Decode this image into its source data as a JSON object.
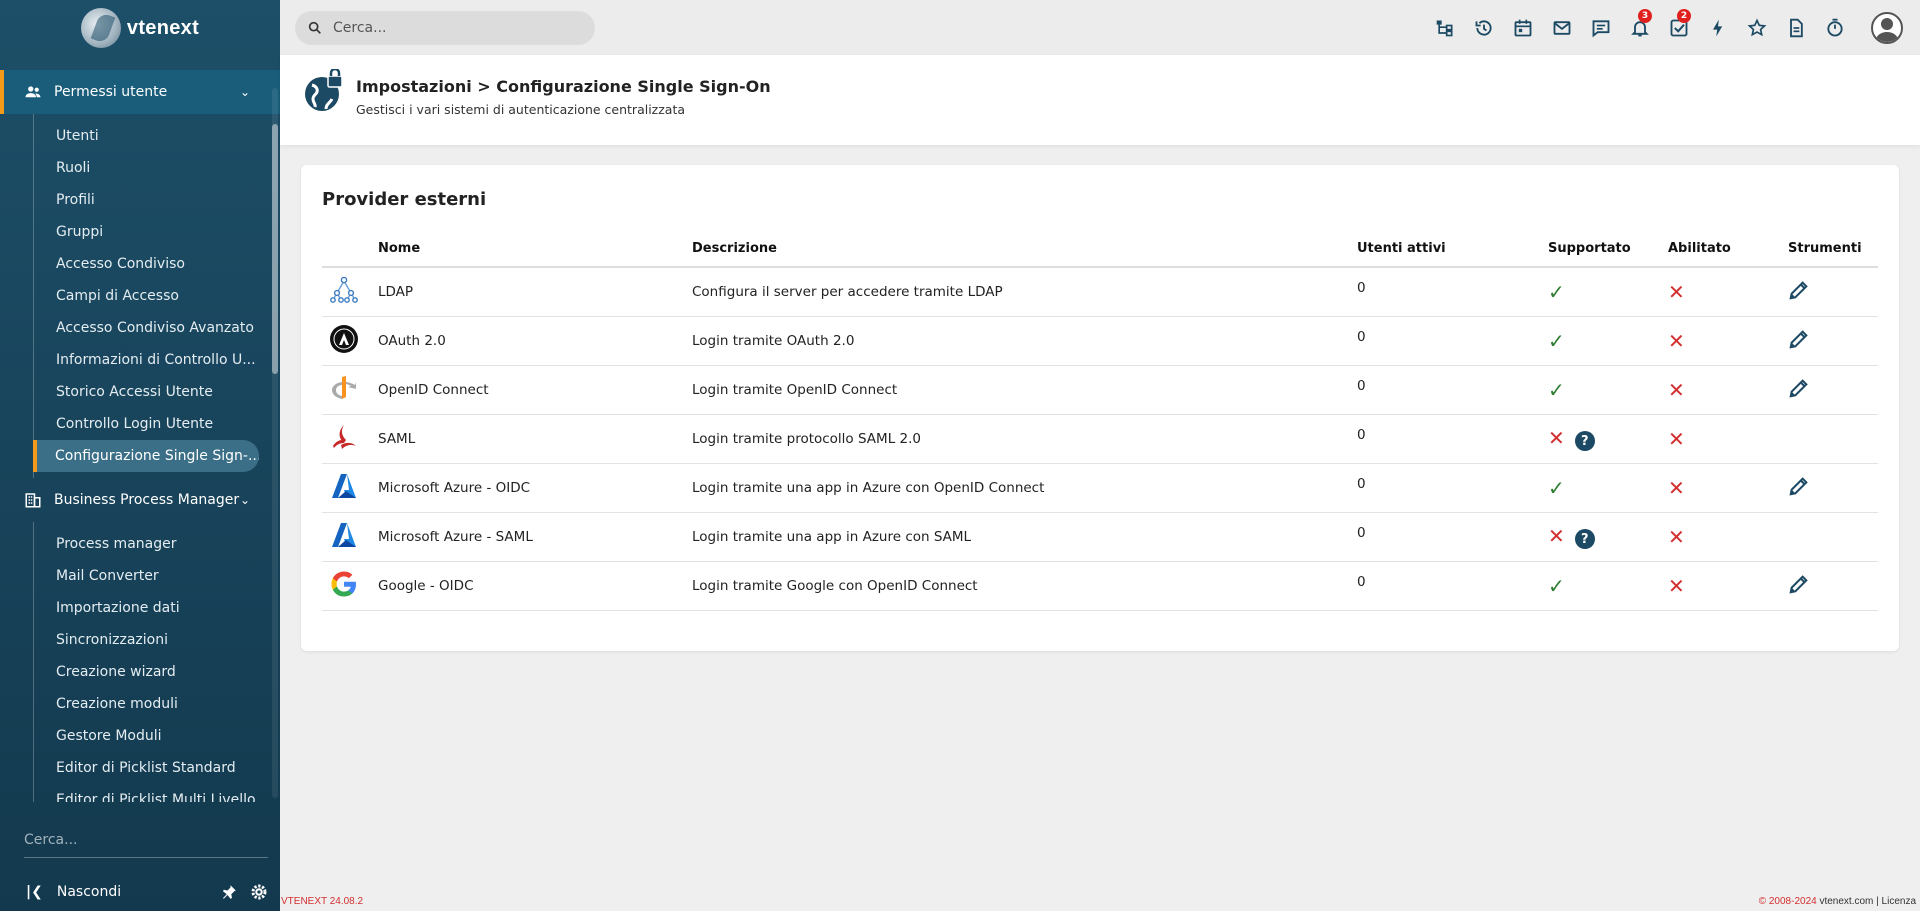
{
  "app": {
    "logo_text": "vtenext",
    "version": "VTENEXT 24.08.2"
  },
  "topbar": {
    "search_placeholder": "Cerca...",
    "icons": [
      {
        "name": "org-chart-icon",
        "badge": null
      },
      {
        "name": "history-icon",
        "badge": null
      },
      {
        "name": "calendar-icon",
        "badge": null
      },
      {
        "name": "mail-icon",
        "badge": null
      },
      {
        "name": "chat-icon",
        "badge": null
      },
      {
        "name": "bell-icon",
        "badge": "3"
      },
      {
        "name": "task-check-icon",
        "badge": "2"
      },
      {
        "name": "bolt-icon",
        "badge": null
      },
      {
        "name": "star-icon",
        "badge": null
      },
      {
        "name": "document-icon",
        "badge": null
      },
      {
        "name": "timer-icon",
        "badge": null
      }
    ]
  },
  "sidebar": {
    "sections": [
      {
        "label": "Permessi utente",
        "icon": "users-icon",
        "items": [
          "Utenti",
          "Ruoli",
          "Profili",
          "Gruppi",
          "Accesso Condiviso",
          "Campi di Accesso",
          "Accesso Condiviso Avanzato",
          "Informazioni di Controllo U...",
          "Storico Accessi Utente",
          "Controllo Login Utente",
          "Configurazione Single Sign-..."
        ]
      },
      {
        "label": "Business Process Manager",
        "icon": "building-icon",
        "items": [
          "Process manager",
          "Mail Converter",
          "Importazione dati",
          "Sincronizzazioni",
          "Creazione wizard",
          "Creazione moduli",
          "Gestore Moduli",
          "Editor di Picklist Standard",
          "Editor di Picklist Multi Livello"
        ]
      }
    ],
    "search_placeholder": "Cerca...",
    "hide_label": "Nascondi"
  },
  "header": {
    "title": "Impostazioni > Configurazione Single Sign-On",
    "subtitle": "Gestisci i vari sistemi di autenticazione centralizzata"
  },
  "card": {
    "title": "Provider esterni",
    "columns": [
      "Nome",
      "Descrizione",
      "Utenti attivi",
      "Supportato",
      "Abilitato",
      "Strumenti"
    ],
    "rows": [
      {
        "icon": "ldap-icon",
        "name": "LDAP",
        "desc": "Configura il server per accedere tramite LDAP",
        "users": "0",
        "supported": true,
        "enabled": false,
        "editable": true
      },
      {
        "icon": "oauth-icon",
        "name": "OAuth 2.0",
        "desc": "Login tramite OAuth 2.0",
        "users": "0",
        "supported": true,
        "enabled": false,
        "editable": true
      },
      {
        "icon": "openid-icon",
        "name": "OpenID Connect",
        "desc": "Login tramite OpenID Connect",
        "users": "0",
        "supported": true,
        "enabled": false,
        "editable": true
      },
      {
        "icon": "saml-icon",
        "name": "SAML",
        "desc": "Login tramite protocollo SAML 2.0",
        "users": "0",
        "supported": false,
        "enabled": false,
        "editable": false
      },
      {
        "icon": "azure-icon",
        "name": "Microsoft Azure - OIDC",
        "desc": "Login tramite una app in Azure con OpenID Connect",
        "users": "0",
        "supported": true,
        "enabled": false,
        "editable": true
      },
      {
        "icon": "azure-icon",
        "name": "Microsoft Azure - SAML",
        "desc": "Login tramite una app in Azure con SAML",
        "users": "0",
        "supported": false,
        "enabled": false,
        "editable": false
      },
      {
        "icon": "google-icon",
        "name": "Google - OIDC",
        "desc": "Login tramite Google con OpenID Connect",
        "users": "0",
        "supported": true,
        "enabled": false,
        "editable": true
      }
    ]
  },
  "footer": {
    "copyright_prefix": "© 2008-2024",
    "copyright_site": " vtenext.com | Licenza"
  }
}
